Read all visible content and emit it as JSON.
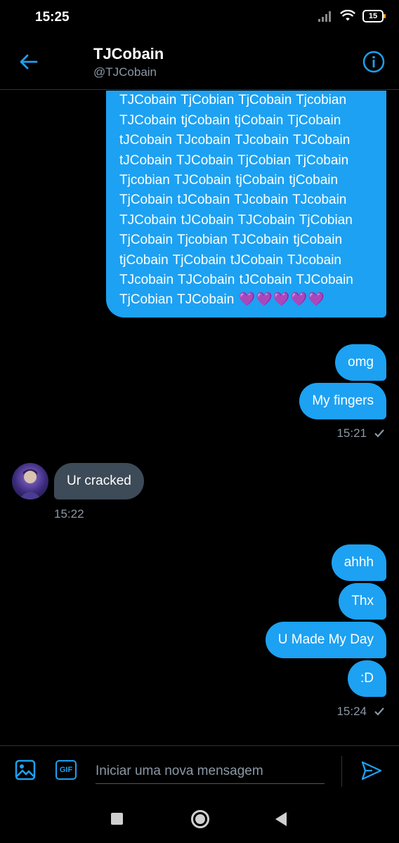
{
  "status_bar": {
    "time": "15:25",
    "battery": "15"
  },
  "header": {
    "name": "TJCobain",
    "handle": "@TJCobain",
    "back_icon": "arrow-left-icon",
    "info_icon": "info-circle-icon"
  },
  "messages": {
    "long_message_text": "TjCobain TjCobain TjcobianTJCobain TJCobain TjCobian TjCobain Tjcobian TJCobain tjCobain tjCobain TjCobain tJCobain TJcobain TJcobain TJCobain tJCobain TJCobain TjCobian TjCobain Tjcobian TJCobain tjCobain tjCobain TjCobain tJCobain TJcobain TJcobain TJCobain tJCobain TJCobain TjCobian TjCobain Tjcobian TJCobain tjCobain tjCobain TjCobain tJCobain TJcobain TJcobain TJCobain tJCobain TJCobain TjCobian TJCobain",
    "hearts": "💜💜💜💜💜",
    "out_1": "omg",
    "out_2": "My fingers",
    "time_1": "15:21",
    "in_1": "Ur cracked",
    "time_2": "15:22",
    "out_3": "ahhh",
    "out_4": "Thx",
    "out_5": "U Made My Day",
    "out_6": ":D",
    "time_3": "15:24"
  },
  "composer": {
    "placeholder": "Iniciar uma nova mensagem",
    "gif_label": "GIF",
    "image_icon": "image-icon",
    "send_icon": "send-icon"
  },
  "colors": {
    "accent": "#1da1f2",
    "incoming_bubble": "#3d4a57",
    "background": "#000000"
  }
}
